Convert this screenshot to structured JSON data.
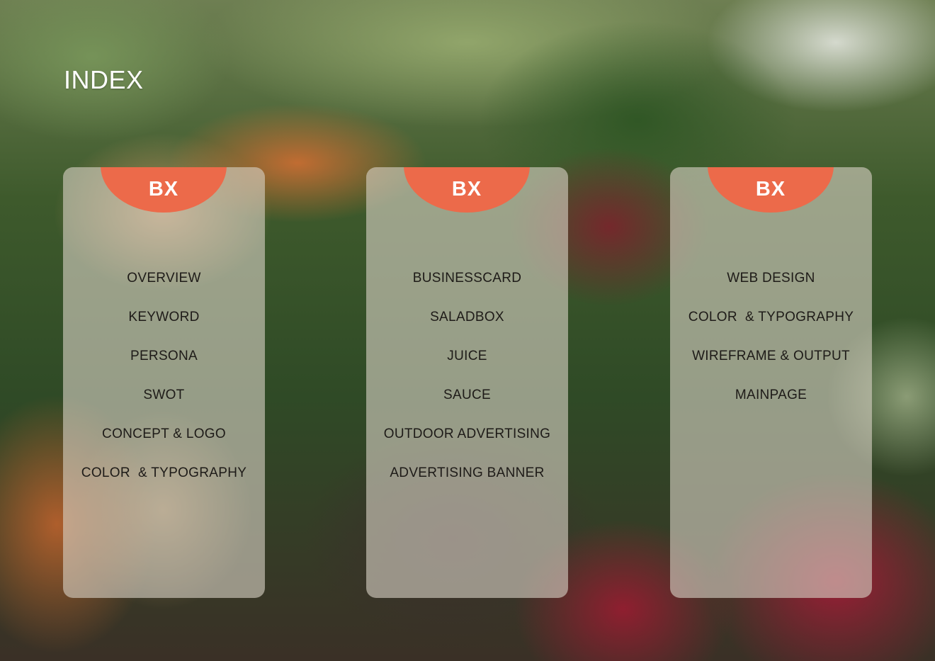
{
  "page": {
    "title": "INDEX"
  },
  "colors": {
    "accent": "#ec6a4a",
    "card": "#d7d0c4",
    "text": "#1e1b18",
    "title": "#ffffff"
  },
  "background": {
    "icon": "vegetable-market-photo"
  },
  "cards": [
    {
      "badge": "BX",
      "items": [
        "OVERVIEW",
        "KEYWORD",
        "PERSONA",
        "SWOT",
        "CONCEPT & LOGO",
        "COLOR  & TYPOGRAPHY"
      ]
    },
    {
      "badge": "BX",
      "items": [
        "BUSINESSCARD",
        "SALADBOX",
        "JUICE",
        "SAUCE",
        "OUTDOOR ADVERTISING",
        "ADVERTISING BANNER"
      ]
    },
    {
      "badge": "BX",
      "items": [
        "WEB DESIGN",
        "COLOR  & TYPOGRAPHY",
        "WIREFRAME & OUTPUT",
        "MAINPAGE"
      ]
    }
  ]
}
